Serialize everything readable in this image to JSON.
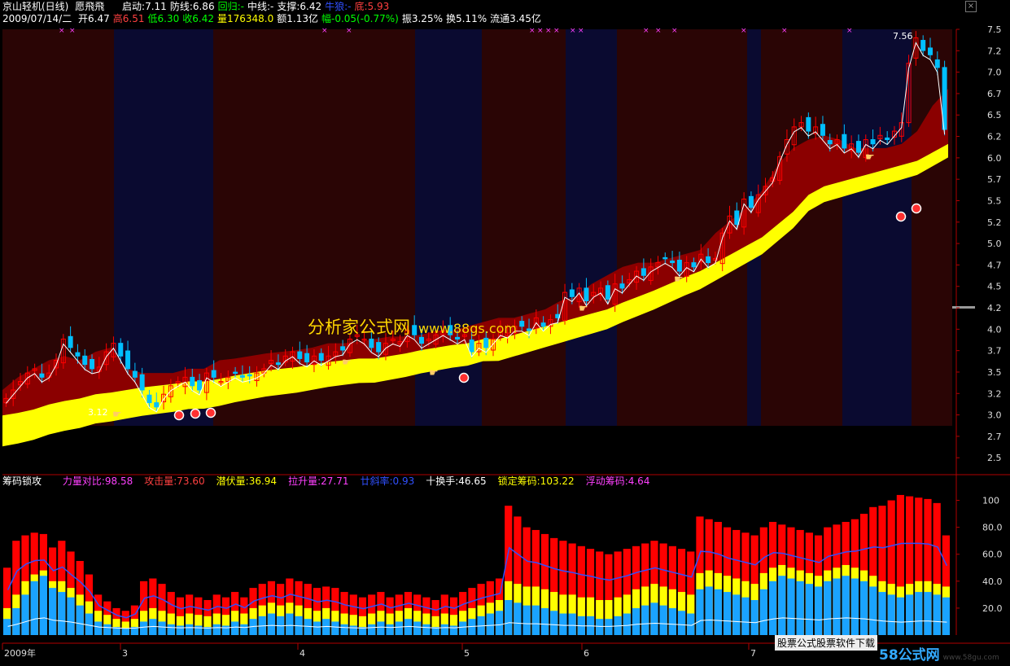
{
  "header": {
    "name": "京山轻机(日线)",
    "indicator": "愿飛飛",
    "items": [
      {
        "label": "启动:7.11",
        "color": "#ffffff"
      },
      {
        "label": "防线:6.86",
        "color": "#ffffff"
      },
      {
        "label": "回归:-",
        "color": "#00ff00"
      },
      {
        "label": "中线:-",
        "color": "#ffffff"
      },
      {
        "label": "支撑:6.42",
        "color": "#ffffff"
      },
      {
        "label": "牛狼:-",
        "color": "#3050ff"
      },
      {
        "label": "底:5.93",
        "color": "#ff4040"
      }
    ]
  },
  "quote": {
    "date": "2009/07/14/二",
    "items": [
      {
        "label": "开6.47",
        "color": "#ffffff"
      },
      {
        "label": "高6.51",
        "color": "#ff4040"
      },
      {
        "label": "低6.30",
        "color": "#00ff00"
      },
      {
        "label": "收6.42",
        "color": "#00ff00"
      },
      {
        "label": "量176348.0",
        "color": "#ffff00"
      },
      {
        "label": "额1.13亿",
        "color": "#ffffff"
      },
      {
        "label": "幅-0.05(-0.77%)",
        "color": "#00ff00"
      },
      {
        "label": "振3.25%",
        "color": "#ffffff"
      },
      {
        "label": "换5.11%",
        "color": "#ffffff"
      },
      {
        "label": "流通3.45亿",
        "color": "#ffffff"
      }
    ]
  },
  "lower_header": {
    "title": "筹码锁攻",
    "items": [
      {
        "label": "力量对比:98.58",
        "color": "#ff40ff"
      },
      {
        "label": "攻击量:73.60",
        "color": "#ff4040"
      },
      {
        "label": "潜伏量:36.94",
        "color": "#ffff00"
      },
      {
        "label": "拉升量:27.71",
        "color": "#ff40ff"
      },
      {
        "label": "廿斜率:0.93",
        "color": "#3050ff"
      },
      {
        "label": "十换手:46.65",
        "color": "#ffffff"
      },
      {
        "label": "锁定筹码:103.22",
        "color": "#ffff00"
      },
      {
        "label": "浮动筹码:4.64",
        "color": "#ff40ff"
      }
    ]
  },
  "watermark": {
    "text": "分析家公式网",
    "url": "www.88gs.com"
  },
  "footer": {
    "text": "股票公式股票软件下载",
    "logo": "58公式网",
    "logo_url": "www.58gu.com"
  },
  "colors": {
    "up": "#ff0000",
    "down": "#00bfff",
    "band_red": "#8b0000",
    "band_yellow": "#ffff00",
    "bg_red": "#2a0505",
    "bg_blue": "#0a0a30"
  },
  "chart_data": [
    {
      "type": "candlestick",
      "y_ticks": [
        "7.5",
        "7.2",
        "7.0",
        "6.7",
        "6.5",
        "6.2",
        "6.0",
        "5.7",
        "5.5",
        "5.2",
        "5.0",
        "4.7",
        "4.5",
        "4.2",
        "4.0",
        "3.7",
        "3.5",
        "3.2",
        "3.0",
        "2.7",
        "2.5"
      ],
      "ylim": [
        2.4,
        7.6
      ],
      "x_labels": [
        "2009年",
        "3",
        "4",
        "5",
        "6",
        "7"
      ],
      "annotations": [
        "7.56",
        "3.12"
      ],
      "close": [
        3.25,
        3.35,
        3.45,
        3.55,
        3.6,
        3.5,
        3.55,
        3.7,
        3.95,
        3.85,
        3.75,
        3.65,
        3.6,
        3.62,
        3.8,
        3.9,
        3.75,
        3.6,
        3.5,
        3.35,
        3.2,
        3.15,
        3.3,
        3.4,
        3.45,
        3.5,
        3.4,
        3.35,
        3.55,
        3.5,
        3.45,
        3.5,
        3.55,
        3.5,
        3.52,
        3.55,
        3.6,
        3.7,
        3.65,
        3.75,
        3.8,
        3.72,
        3.68,
        3.75,
        3.7,
        3.75,
        3.8,
        3.82,
        3.95,
        4.0,
        3.95,
        3.85,
        3.8,
        3.9,
        3.95,
        3.92,
        4.05,
        4.0,
        3.9,
        3.95,
        4.0,
        4.05,
        4.0,
        3.95,
        4.0,
        3.8,
        3.9,
        3.85,
        3.95,
        4.05,
        4.02,
        4.1,
        4.1,
        4.05,
        4.2,
        4.1,
        4.18,
        4.2,
        4.5,
        4.45,
        4.55,
        4.4,
        4.5,
        4.55,
        4.42,
        4.6,
        4.55,
        4.65,
        4.75,
        4.7,
        4.8,
        4.85,
        4.9,
        4.85,
        4.75,
        4.85,
        4.8,
        4.95,
        4.85,
        4.9,
        5.2,
        5.4,
        5.3,
        5.6,
        5.5,
        5.65,
        5.75,
        5.85,
        6.1,
        6.3,
        6.45,
        6.5,
        6.4,
        6.45,
        6.35,
        6.25,
        6.3,
        6.2,
        6.25,
        6.15,
        6.3,
        6.25,
        6.35,
        6.3,
        6.4,
        6.5,
        7.2,
        7.5,
        7.35,
        7.3,
        7.15,
        6.42
      ],
      "upper_band": [
        3.35,
        3.5,
        3.6,
        3.7,
        3.75,
        3.7,
        3.8,
        3.85,
        3.6,
        3.55,
        3.55,
        3.55,
        3.6,
        3.6,
        3.7,
        3.72,
        3.75,
        3.78,
        3.8,
        3.82,
        3.85,
        3.9,
        3.9,
        3.92,
        3.95,
        3.98,
        3.98,
        4.0,
        4.05,
        4.05,
        4.1,
        4.15,
        4.2,
        4.2,
        4.25,
        4.3,
        4.4,
        4.45,
        4.6,
        4.7,
        4.8,
        4.85,
        4.85,
        4.9,
        4.95,
        5.0,
        5.2,
        5.35,
        5.5,
        5.7,
        6.0,
        6.2,
        6.3,
        6.35,
        6.3,
        6.2,
        6.2,
        6.2,
        6.25,
        6.4,
        6.7,
        6.9
      ],
      "lower_band": [
        3.05,
        3.08,
        3.12,
        3.18,
        3.22,
        3.25,
        3.3,
        3.32,
        3.35,
        3.38,
        3.4,
        3.42,
        3.45,
        3.45,
        3.48,
        3.52,
        3.55,
        3.58,
        3.6,
        3.62,
        3.65,
        3.68,
        3.7,
        3.72,
        3.72,
        3.75,
        3.78,
        3.82,
        3.85,
        3.88,
        3.9,
        3.95,
        3.95,
        4.0,
        4.05,
        4.1,
        4.15,
        4.2,
        4.25,
        4.3,
        4.38,
        4.45,
        4.52,
        4.6,
        4.68,
        4.75,
        4.85,
        4.95,
        5.05,
        5.15,
        5.3,
        5.45,
        5.65,
        5.75,
        5.8,
        5.85,
        5.9,
        5.95,
        6.0,
        6.05,
        6.15,
        6.25
      ]
    },
    {
      "type": "bar",
      "stacked": true,
      "y_ticks": [
        "100",
        "80.0",
        "60.0",
        "40.0",
        "20.0"
      ],
      "ylim": [
        0,
        110
      ],
      "red": [
        50,
        70,
        74,
        76,
        75,
        65,
        70,
        62,
        55,
        45,
        30,
        25,
        20,
        18,
        22,
        40,
        42,
        38,
        32,
        28,
        30,
        28,
        26,
        30,
        28,
        32,
        28,
        35,
        38,
        40,
        38,
        42,
        40,
        38,
        35,
        36,
        35,
        32,
        30,
        28,
        30,
        32,
        28,
        30,
        32,
        30,
        28,
        26,
        30,
        28,
        32,
        35,
        38,
        40,
        42,
        96,
        88,
        80,
        78,
        75,
        72,
        70,
        68,
        66,
        64,
        62,
        60,
        62,
        64,
        66,
        68,
        70,
        68,
        66,
        64,
        62,
        88,
        86,
        84,
        80,
        78,
        76,
        74,
        80,
        84,
        82,
        80,
        78,
        76,
        74,
        80,
        82,
        84,
        86,
        90,
        95,
        96,
        100,
        104,
        103,
        102,
        101,
        98,
        74
      ],
      "yellow": [
        20,
        30,
        40,
        45,
        48,
        40,
        40,
        35,
        30,
        25,
        18,
        15,
        12,
        10,
        12,
        18,
        20,
        18,
        16,
        14,
        16,
        15,
        14,
        16,
        15,
        18,
        16,
        20,
        22,
        24,
        22,
        24,
        22,
        20,
        18,
        20,
        18,
        16,
        15,
        14,
        16,
        18,
        16,
        18,
        20,
        18,
        16,
        14,
        16,
        15,
        18,
        20,
        22,
        24,
        26,
        40,
        38,
        36,
        36,
        34,
        32,
        30,
        30,
        28,
        28,
        26,
        26,
        28,
        30,
        34,
        36,
        38,
        36,
        34,
        32,
        30,
        46,
        48,
        46,
        44,
        42,
        40,
        38,
        46,
        50,
        52,
        50,
        48,
        46,
        44,
        48,
        50,
        52,
        50,
        48,
        44,
        40,
        38,
        36,
        38,
        40,
        40,
        38,
        36
      ],
      "blue": [
        12,
        20,
        30,
        40,
        44,
        35,
        32,
        28,
        22,
        16,
        10,
        8,
        6,
        5,
        6,
        10,
        12,
        10,
        8,
        7,
        8,
        7,
        6,
        8,
        7,
        10,
        8,
        12,
        14,
        16,
        14,
        16,
        14,
        12,
        10,
        12,
        10,
        8,
        7,
        6,
        8,
        10,
        8,
        10,
        12,
        10,
        8,
        6,
        8,
        7,
        10,
        12,
        14,
        16,
        18,
        26,
        24,
        22,
        22,
        20,
        18,
        16,
        16,
        14,
        14,
        12,
        12,
        14,
        16,
        20,
        22,
        24,
        22,
        20,
        18,
        16,
        34,
        36,
        34,
        32,
        30,
        28,
        26,
        34,
        40,
        44,
        42,
        40,
        38,
        36,
        40,
        42,
        44,
        42,
        40,
        36,
        32,
        30,
        28,
        30,
        32,
        32,
        30,
        28
      ]
    }
  ]
}
